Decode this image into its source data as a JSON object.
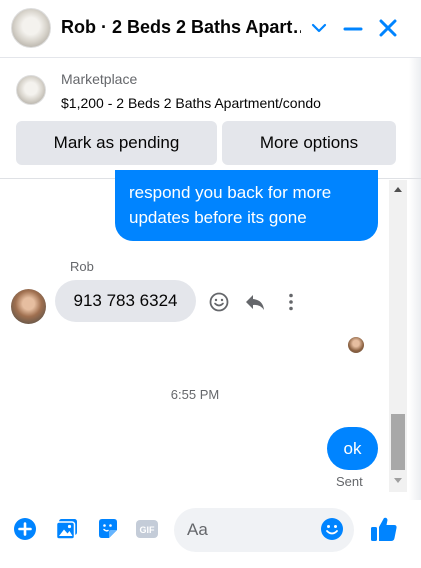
{
  "header": {
    "title": "Rob · 2 Beds 2 Baths Apart…",
    "icons": [
      "chevron-down-icon",
      "minimize-icon",
      "close-icon"
    ]
  },
  "marketplace": {
    "label": "Marketplace",
    "listing": "$1,200 - 2 Beds 2 Baths Apartment/condo",
    "buttons": {
      "pending": "Mark as pending",
      "more": "More options"
    }
  },
  "messages": {
    "outgoing_text": "respond you back for more updates before its gone",
    "sender_name": "Rob",
    "incoming_text": "913 783 6324",
    "timestamp": "6:55 PM",
    "ok_text": "ok",
    "sent_label": "Sent"
  },
  "composer": {
    "placeholder": "Aa",
    "gif_label": "GIF"
  },
  "colors": {
    "accent": "#0084ff",
    "bubble_gray": "#e4e6eb",
    "muted_text": "#65676b"
  }
}
